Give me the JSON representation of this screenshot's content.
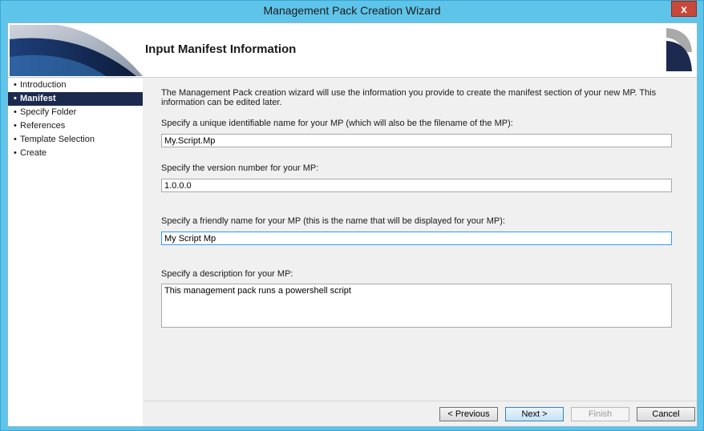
{
  "window": {
    "title": "Management Pack Creation Wizard",
    "close_glyph": "x",
    "accent_color": "#5fc4e9",
    "close_color": "#c7493a"
  },
  "header": {
    "title": "Input Manifest Information",
    "logo_icon": "wizard-logo-icon",
    "banner_icon": "banner-swoosh-icon"
  },
  "sidebar": {
    "bullet": "•",
    "active_color": "#1c2a4f",
    "items": [
      {
        "label": "Introduction",
        "active": false
      },
      {
        "label": "Manifest",
        "active": true
      },
      {
        "label": "Specify Folder",
        "active": false
      },
      {
        "label": "References",
        "active": false
      },
      {
        "label": "Template Selection",
        "active": false
      },
      {
        "label": "Create",
        "active": false
      }
    ]
  },
  "main": {
    "intro": "The Management Pack creation wizard will use the information you provide to create the manifest section of your new MP. This information can be edited later.",
    "name_label": "Specify a unique identifiable name for your MP (which will also be the filename of the MP):",
    "name_value": "My.Script.Mp",
    "version_label": "Specify the version number for your MP:",
    "version_value": "1.0.0.0",
    "friendly_label": "Specify a friendly name for your MP (this is the name that will be displayed for your MP):",
    "friendly_value": "My Script Mp",
    "description_label": "Specify a description for your MP:",
    "description_value": "This management pack runs a powershell script"
  },
  "footer": {
    "previous": "< Previous",
    "next": "Next >",
    "finish": "Finish",
    "cancel": "Cancel"
  }
}
